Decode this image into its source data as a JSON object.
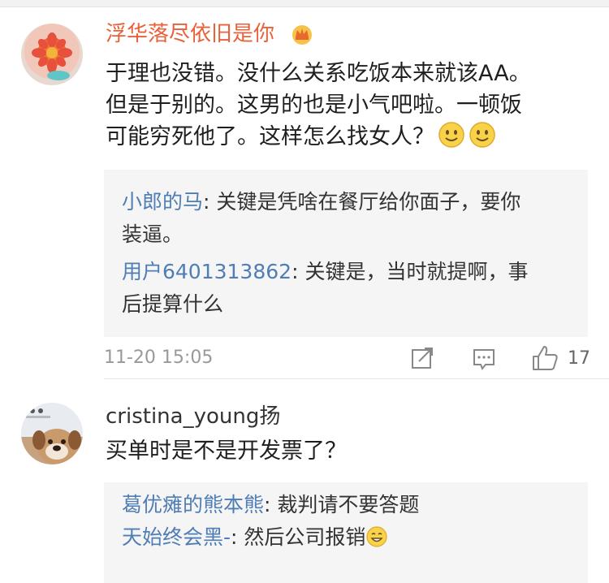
{
  "comments": [
    {
      "username": "浮华落尽依旧是你",
      "text_lines": [
        "于理也没错。没什么关系吃饭本来就该AA。",
        "但是于别的。这男的也是小气吧啦。一顿饭",
        "可能穷死他了。这样怎么找女人？"
      ],
      "emoji": "smile-emoji",
      "replies": [
        {
          "name": "小郎的马",
          "sep": ": ",
          "text_a": "关键是凭啥在餐厅给你面子，要你",
          "text_b": "装逼。"
        },
        {
          "name": "用户6401313862",
          "sep": ": ",
          "text_a": "关键是，当时就提啊，事",
          "text_b": "后提算什么"
        }
      ],
      "time": "11-20 15:05",
      "likes": "17"
    },
    {
      "username": "cristina_young扬",
      "text_lines": [
        "买单时是不是开发票了？"
      ],
      "replies": [
        {
          "name": "葛优瘫的熊本熊",
          "sep": ": ",
          "text_a": "裁判请不要答题"
        },
        {
          "name": "天始终会黑-",
          "sep": ": ",
          "text_a": "然后公司报销"
        }
      ]
    }
  ],
  "colors": {
    "vip_name": "#e8613a",
    "link": "#4f7db5",
    "meta": "#999999",
    "reply_bg": "#f5f5f5"
  },
  "icons": [
    "crown-icon",
    "smile-emoji",
    "repost-icon",
    "comment-icon",
    "like-icon",
    "grin-emoji"
  ]
}
